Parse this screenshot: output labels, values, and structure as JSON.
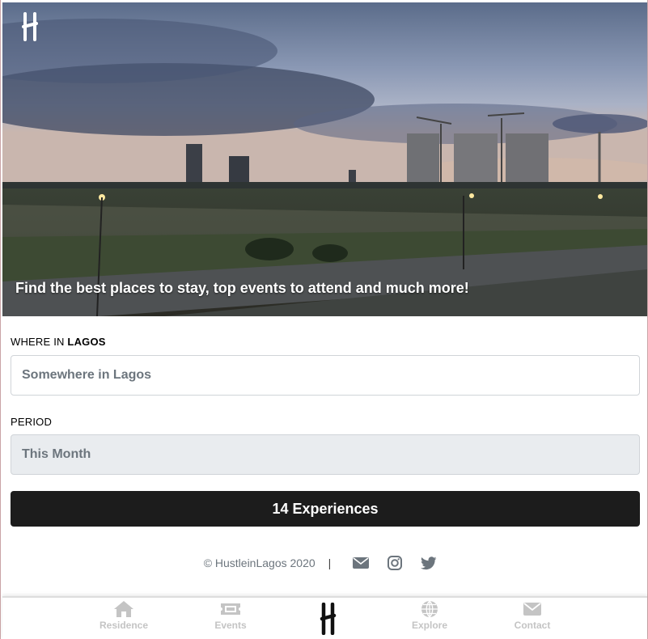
{
  "hero": {
    "tagline": "Find the best places to stay, top events to attend and much more!"
  },
  "search": {
    "where_label_prefix": "WHERE IN",
    "where_label_city": "LAGOS",
    "where_value": "Somewhere in Lagos",
    "period_label": "PERIOD",
    "period_value": "This Month"
  },
  "cta": {
    "label": "14 Experiences"
  },
  "footer": {
    "copyright": "© HustleinLagos 2020",
    "separator": "|",
    "icons": [
      "envelope-icon",
      "instagram-icon",
      "twitter-icon"
    ]
  },
  "bottom_nav": {
    "items": [
      {
        "label": "Residence",
        "icon": "home-icon"
      },
      {
        "label": "Events",
        "icon": "ticket-icon"
      },
      {
        "label": "Explore",
        "icon": "globe-icon"
      },
      {
        "label": "Contact",
        "icon": "envelope-icon"
      }
    ]
  },
  "colors": {
    "cta_bg": "#1c1c1c",
    "field_text": "#6c757d",
    "period_bg": "#e9ecef",
    "nav_inactive": "#c4c4c4"
  }
}
